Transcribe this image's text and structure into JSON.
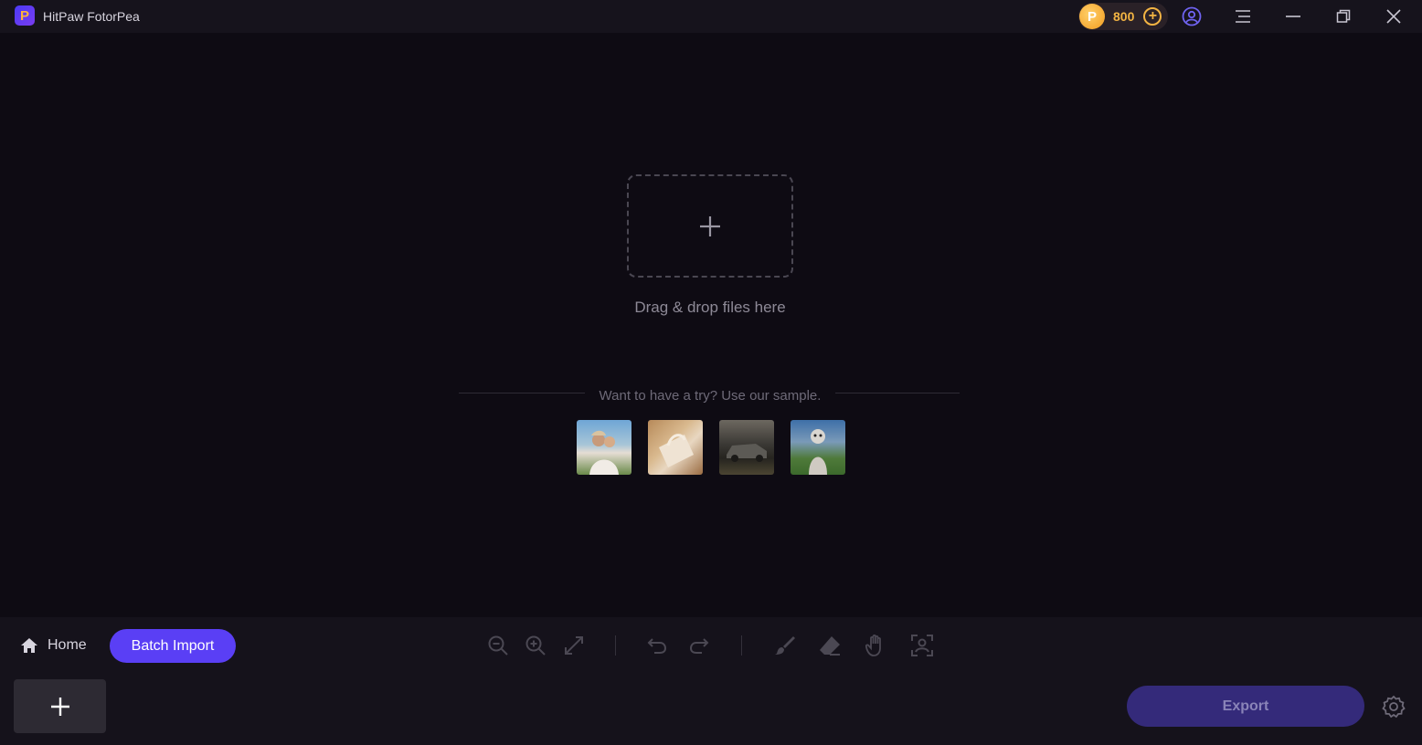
{
  "app": {
    "title": "HitPaw FotorPea",
    "logo_letter": "P"
  },
  "header": {
    "coin_count": "800",
    "coin_letter": "P",
    "coin_add": "+"
  },
  "dropzone": {
    "text": "Drag & drop files here"
  },
  "samples": {
    "prompt": "Want to have a try? Use our sample.",
    "items": [
      "sample-couple",
      "sample-bag",
      "sample-car",
      "sample-dog"
    ]
  },
  "toolbar": {
    "home_label": "Home",
    "batch_import_label": "Batch Import",
    "export_label": "Export"
  },
  "colors": {
    "accent": "#5a3ff5",
    "background": "#0e0b13",
    "coin": "#f3b443"
  }
}
